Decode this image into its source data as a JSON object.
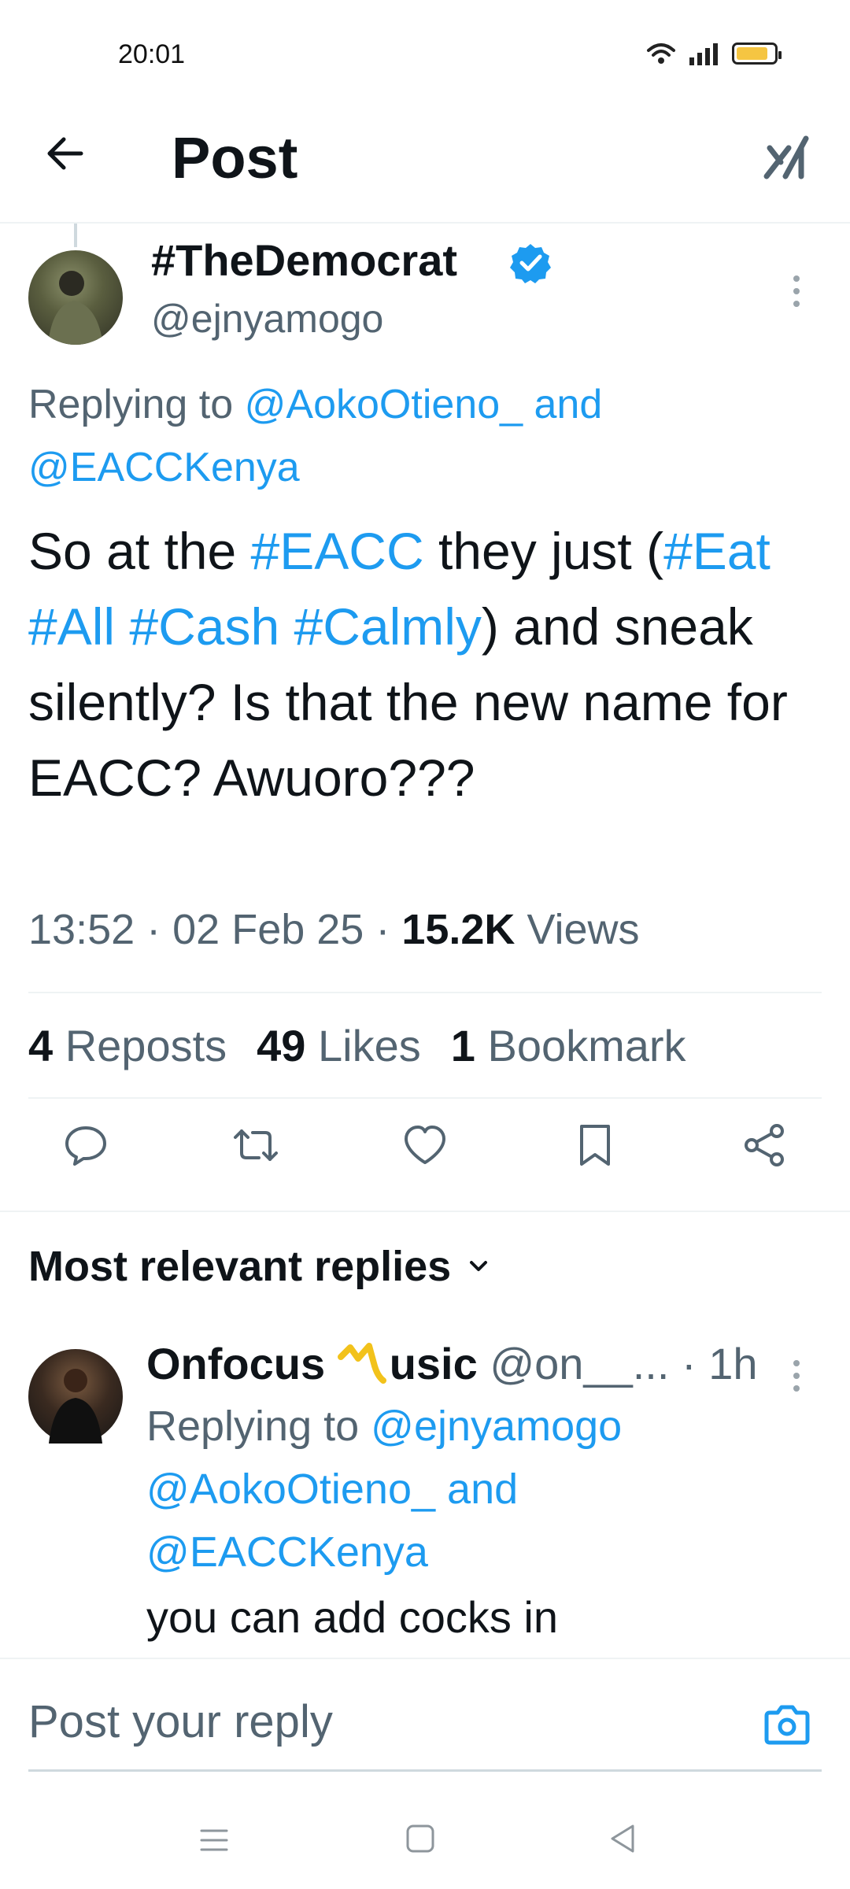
{
  "status_bar": {
    "time": "20:01",
    "battery_level": 0.85
  },
  "header": {
    "title": "Post",
    "back_icon": "arrow-left-icon",
    "grok_icon": "grok-icon"
  },
  "post": {
    "author_name": "#TheDemocrat",
    "author_handle": "@ejnyamogo",
    "replying_prefix": "Replying to ",
    "replying_to_1": "@AokoOtieno_",
    "replying_joiner": " and",
    "replying_to_2": "@EACCKenya",
    "text_1": "So at the ",
    "hashtag_eacc": "#EACC",
    "text_2": " they just (",
    "hashtag_eat": "#Eat",
    "hashtag_all": "#All",
    "hashtag_cash": "#Cash",
    "hashtag_calmly": "#Calmly",
    "text_3": ") and sneak silently? Is that the new name for EACC? Awuoro???",
    "time": "13:52",
    "date": "02 Feb 25",
    "views_count": "15.2K",
    "views_label": "Views",
    "separator": " · "
  },
  "stats": {
    "reposts_count": "4",
    "reposts_label": "Reposts",
    "likes_count": "49",
    "likes_label": "Likes",
    "bookmarks_count": "1",
    "bookmarks_label": "Bookmark"
  },
  "replies_header": {
    "label": "Most relevant replies"
  },
  "reply": {
    "name": "Onfocus ",
    "name_suffix": "usic",
    "handle": "@on__...",
    "age": "· 1h",
    "replying_prefix": "Replying to ",
    "replying_to_1": "@ejnyamogo",
    "replying_to_2": "@AokoOtieno_",
    "replying_joiner": " and",
    "replying_to_3": "@EACCKenya",
    "text": "you can add cocks in"
  },
  "composer": {
    "placeholder": "Post your reply"
  },
  "colors": {
    "link": "#1d9bf0",
    "secondary_text": "#536471",
    "verified": "#1d9bf0"
  }
}
